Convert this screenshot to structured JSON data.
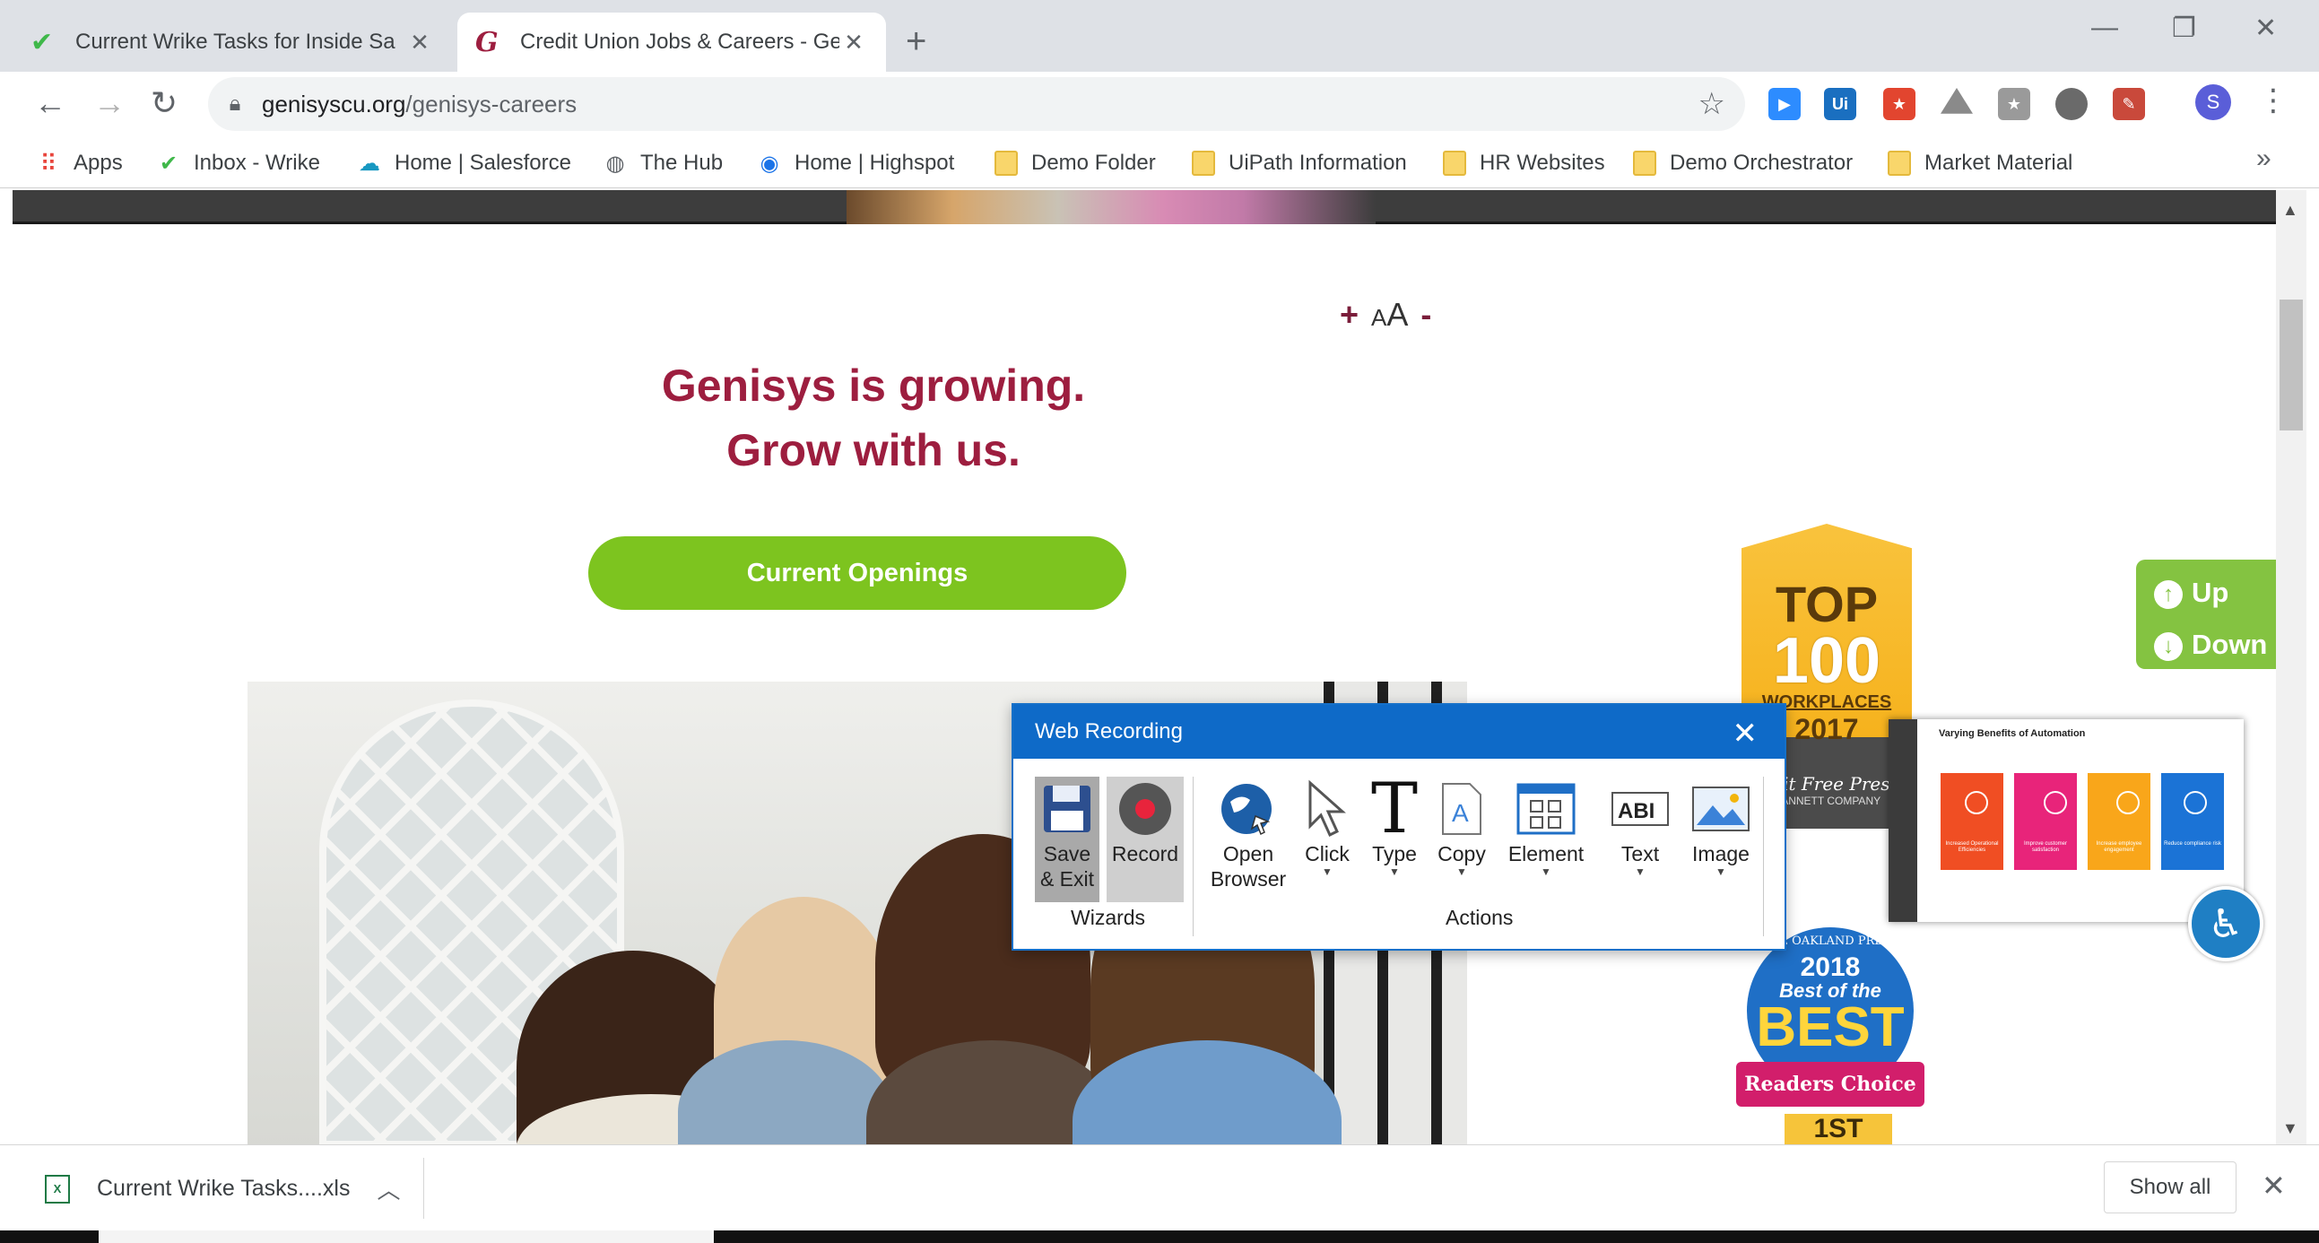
{
  "browser": {
    "tabs": [
      {
        "title": "Current Wrike Tasks for Inside Sa",
        "favicon": "wrike-check-icon",
        "active": false
      },
      {
        "title": "Credit Union Jobs & Careers - Ge",
        "favicon": "genisys-g-icon",
        "active": true
      }
    ],
    "new_tab": "+",
    "url_host": "genisyscu.org",
    "url_path": "/genisys-careers",
    "profile_initial": "S",
    "bookmarks": [
      {
        "label": "Apps",
        "icon": "apps-grid-icon"
      },
      {
        "label": "Inbox - Wrike",
        "icon": "wrike-check-icon"
      },
      {
        "label": "Home | Salesforce",
        "icon": "salesforce-cloud-icon"
      },
      {
        "label": "The Hub",
        "icon": "globe-icon"
      },
      {
        "label": "Home | Highspot",
        "icon": "highspot-icon"
      },
      {
        "label": "Demo Folder",
        "icon": "folder-icon"
      },
      {
        "label": "UiPath Information",
        "icon": "folder-icon"
      },
      {
        "label": "HR Websites",
        "icon": "folder-icon"
      },
      {
        "label": "Demo Orchestrator",
        "icon": "folder-icon"
      },
      {
        "label": "Market Material",
        "icon": "folder-icon"
      }
    ],
    "bookmarks_overflow": "»",
    "extensions": [
      {
        "name": "zoom-icon",
        "color": "#2d8cff"
      },
      {
        "name": "uipath-icon",
        "color": "#1a6fc0",
        "label": "Ui"
      },
      {
        "name": "calendar-icon",
        "color": "#e2452f"
      },
      {
        "name": "drive-icon",
        "color": "#8a8a8a"
      },
      {
        "name": "bookmark-icon",
        "color": "#9a9a9a"
      },
      {
        "name": "circle-ext-icon",
        "color": "#6a6a6a"
      },
      {
        "name": "pdf-icon",
        "color": "#c9493b"
      }
    ]
  },
  "page": {
    "font_controls": {
      "plus": "+",
      "aa_small": "A",
      "aa_big": "A",
      "minus": "-"
    },
    "headline_line1": "Genisys is growing.",
    "headline_line2": "Grow with us.",
    "cta_label": "Current Openings",
    "badge_top": {
      "line1": "TOP",
      "line2": "100",
      "line3": "WORKPLACES",
      "year": "2017",
      "paper": "roit Free Pres",
      "company": "GANNETT COMPANY"
    },
    "badge_best": {
      "small": "THE OAKLAND PRESS",
      "year": "2018",
      "best_of": "Best of the",
      "best": "BEST",
      "ribbon": "Readers Choice Awards",
      "first": "1ST"
    },
    "updown": {
      "up": "Up",
      "down": "Down"
    },
    "automation": {
      "title": "Varying Benefits of Automation",
      "cards": [
        {
          "text": "Increased Operational Efficiencies",
          "color": "#f04e23"
        },
        {
          "text": "Improve customer satisfaction",
          "color": "#e8247a"
        },
        {
          "text": "Increase employee engagement",
          "color": "#f9a61a"
        },
        {
          "text": "Reduce compliance risk",
          "color": "#1b73d6"
        }
      ]
    }
  },
  "recorder": {
    "title": "Web Recording",
    "buttons": {
      "save_exit": "Save & Exit",
      "record": "Record",
      "open_browser": "Open Browser",
      "click": "Click",
      "type": "Type",
      "copy": "Copy",
      "element": "Element",
      "text": "Text",
      "image": "Image"
    },
    "groups": {
      "wizards": "Wizards",
      "actions": "Actions"
    }
  },
  "downloads": {
    "file": "Current Wrike Tasks....xls",
    "show_all": "Show all"
  }
}
